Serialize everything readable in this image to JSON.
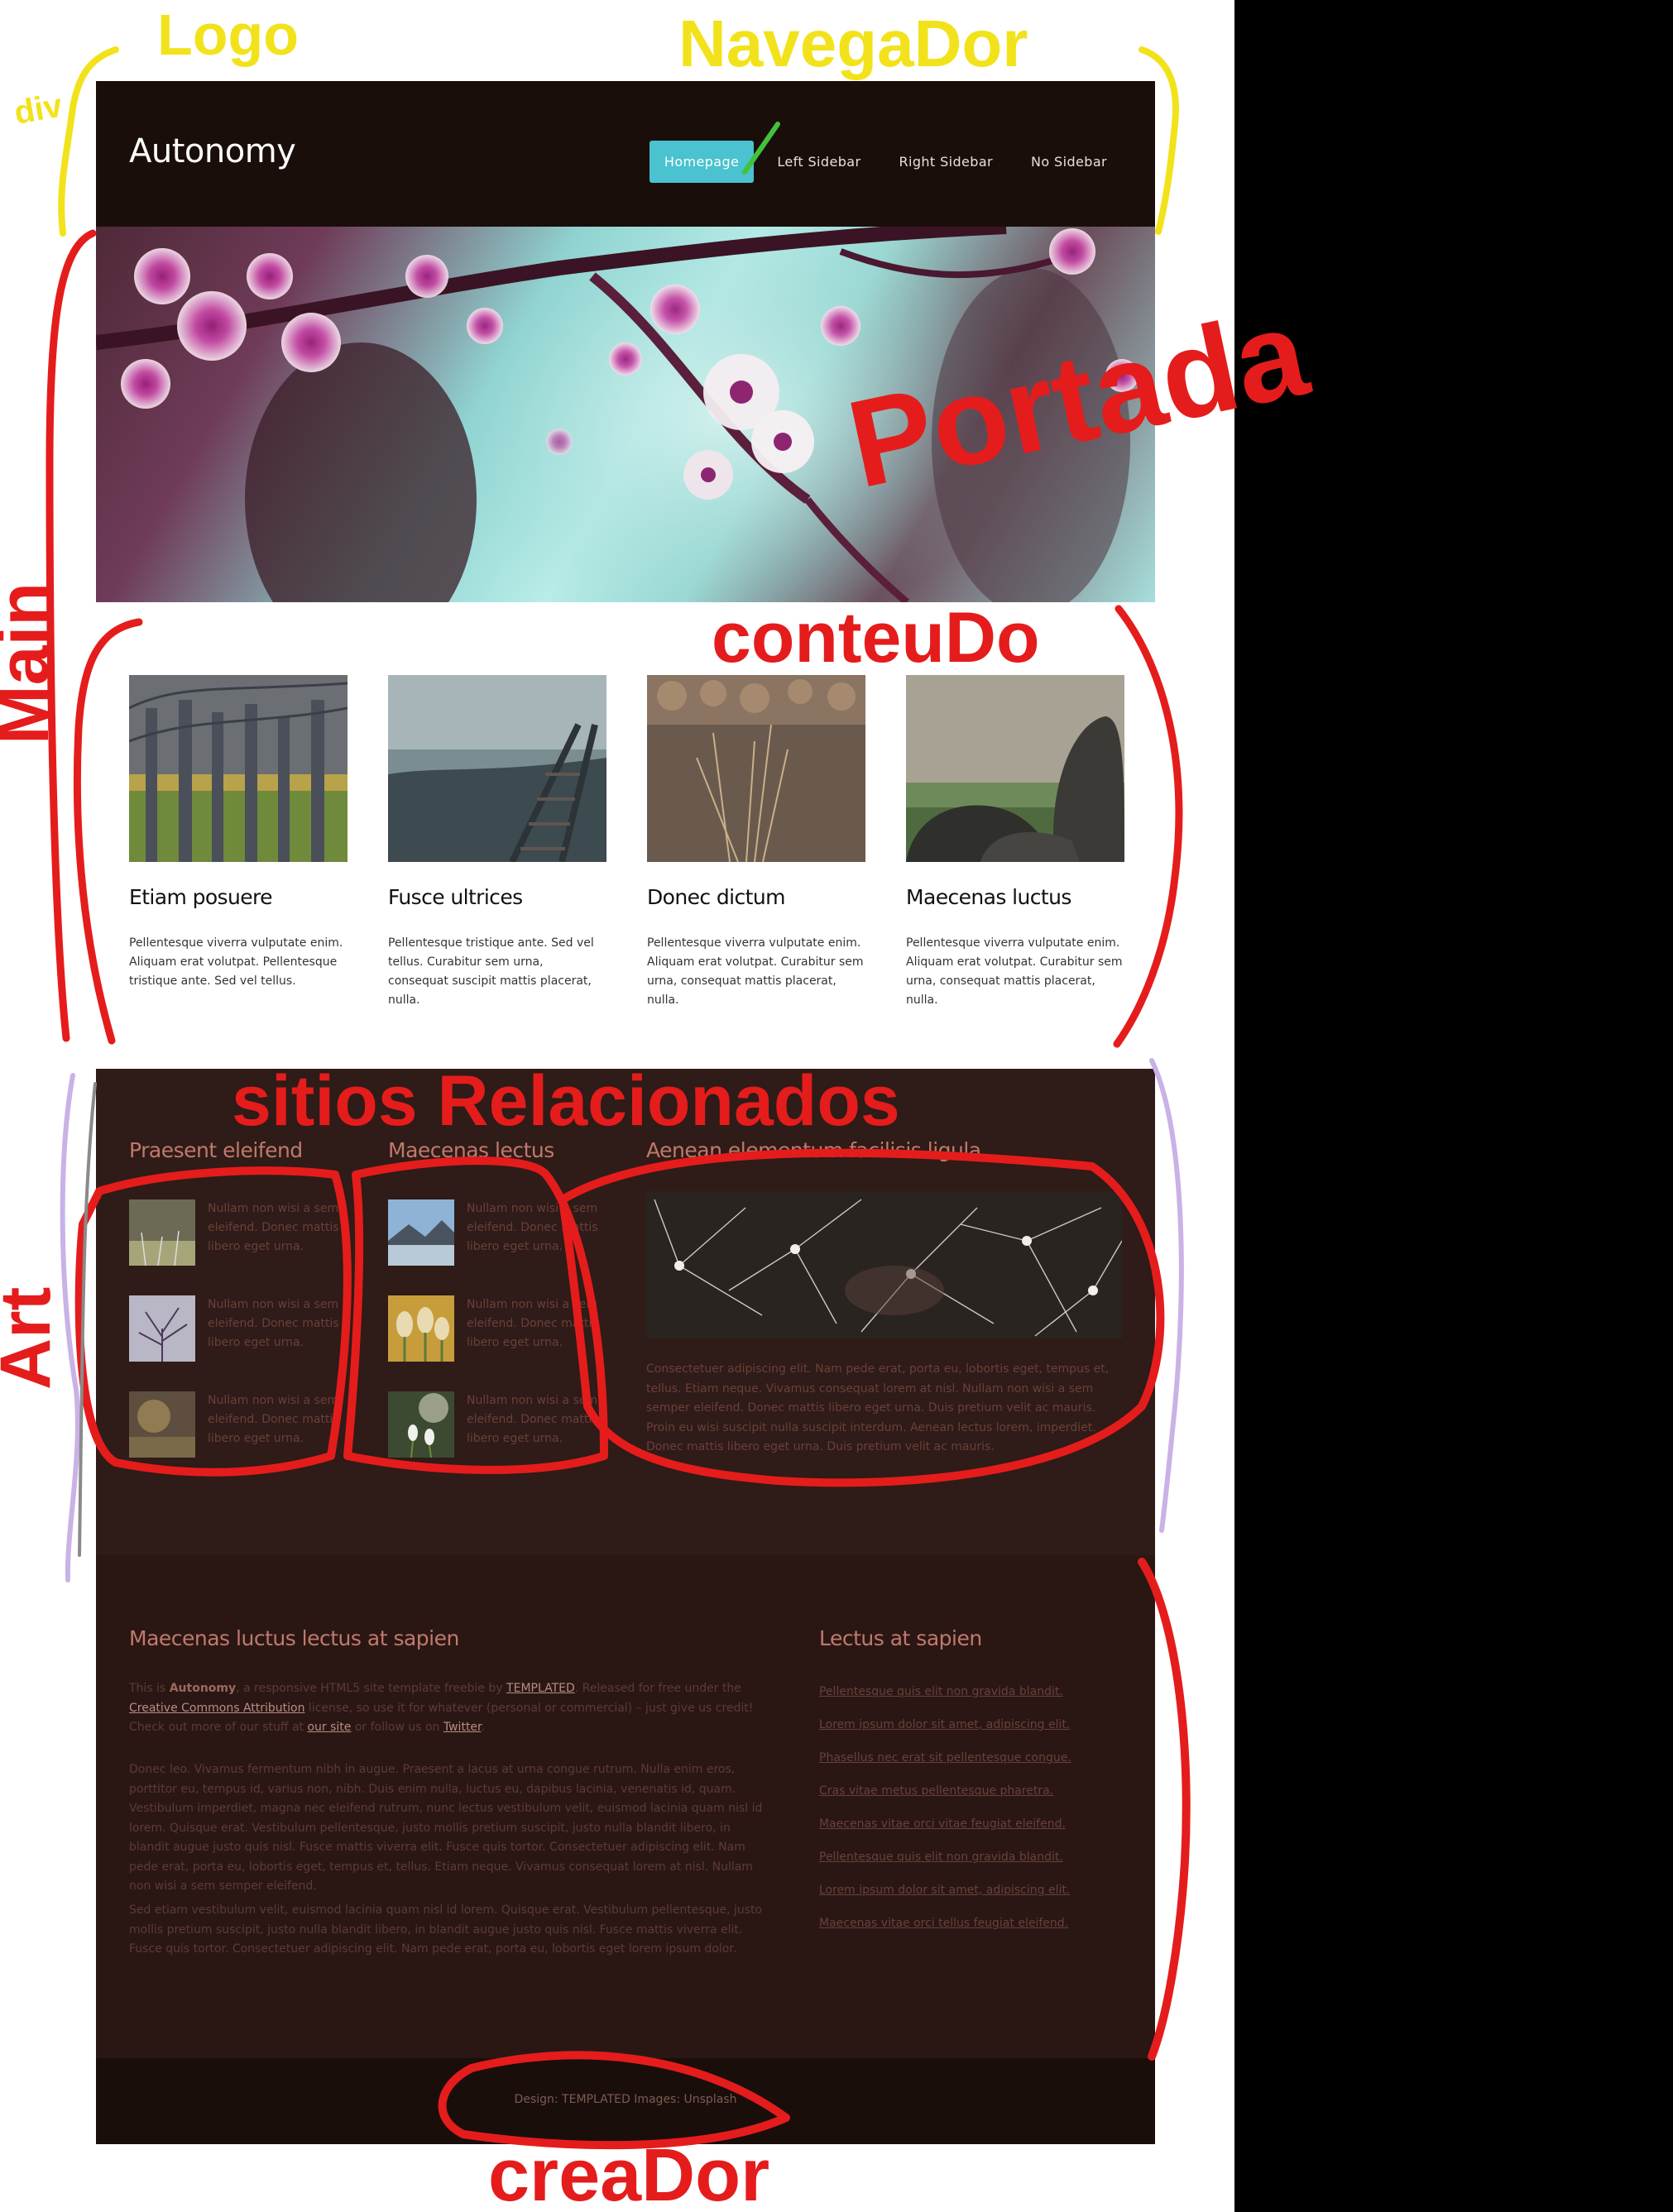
{
  "site": {
    "logo": "Autonomy",
    "nav": [
      {
        "label": "Homepage",
        "active": true
      },
      {
        "label": "Left Sidebar",
        "active": false
      },
      {
        "label": "Right Sidebar",
        "active": false
      },
      {
        "label": "No Sidebar",
        "active": false
      }
    ],
    "accent": "#4ac2cf"
  },
  "content": {
    "cards": [
      {
        "title": "Etiam posuere",
        "text": "Pellentesque viverra vulputate enim. Aliquam erat volutpat. Pellentesque tristique ante. Sed vel tellus."
      },
      {
        "title": "Fusce ultrices",
        "text": "Pellentesque tristique ante. Sed vel tellus. Curabitur sem urna, consequat suscipit mattis placerat, nulla."
      },
      {
        "title": "Donec dictum",
        "text": "Pellentesque viverra vulputate enim. Aliquam erat volutpat. Curabitur sem urna, consequat mattis placerat, nulla."
      },
      {
        "title": "Maecenas luctus",
        "text": "Pellentesque viverra vulputate enim. Aliquam erat volutpat. Curabitur sem urna, consequat mattis placerat, nulla."
      }
    ]
  },
  "related": {
    "col1_title": "Praesent eleifend",
    "col2_title": "Maecenas lectus",
    "col3_title": "Aenean elementum facilisis ligula",
    "item_text": "Nullam non wisi a sem eleifend. Donec mattis libero eget urna.",
    "featured_text": "Consectetuer adipiscing elit. Nam pede erat, porta eu, lobortis eget, tempus et, tellus. Etiam neque. Vivamus consequat lorem at nisl. Nullam non wisi a sem semper eleifend. Donec mattis libero eget urna. Duis pretium velit ac mauris. Proin eu wisi suscipit nulla suscipit interdum. Aenean lectus lorem, imperdiet. Donec mattis libero eget urna. Duis pretium velit ac mauris."
  },
  "footer": {
    "left_title": "Maecenas luctus lectus at sapien",
    "intro": {
      "p1": "This is ",
      "brand": "Autonomy",
      "p2": ", a responsive HTML5 site template freebie by ",
      "link1": "TEMPLATED",
      "p3": ". Released for free under the ",
      "link2": "Creative Commons Attribution",
      "p4": " license, so use it for whatever (personal or commercial) – just give us credit! Check out more of our stuff at ",
      "link3": "our site",
      "p5": " or follow us on ",
      "link4": "Twitter",
      "p6": "."
    },
    "para2": "Donec leo. Vivamus fermentum nibh in augue. Praesent a lacus at urna congue rutrum. Nulla enim eros, porttitor eu, tempus id, varius non, nibh. Duis enim nulla, luctus eu, dapibus lacinia, venenatis id, quam. Vestibulum imperdiet, magna nec eleifend rutrum, nunc lectus vestibulum velit, euismod lacinia quam nisl id lorem. Quisque erat. Vestibulum pellentesque, justo mollis pretium suscipit, justo nulla blandit libero, in blandit augue justo quis nisl. Fusce mattis viverra elit. Fusce quis tortor. Consectetuer adipiscing elit. Nam pede erat, porta eu, lobortis eget, tempus et, tellus. Etiam neque. Vivamus consequat lorem at nisl. Nullam non wisi a sem semper eleifend.",
    "para3": "Sed etiam vestibulum velit, euismod lacinia quam nisl id lorem. Quisque erat. Vestibulum pellentesque, justo mollis pretium suscipit, justo nulla blandit libero, in blandit augue justo quis nisl. Fusce mattis viverra elit. Fusce quis tortor. Consectetuer adipiscing elit. Nam pede erat, porta eu, lobortis eget lorem ipsum dolor.",
    "right_title": "Lectus at sapien",
    "links": [
      "Pellentesque quis elit non gravida blandit.",
      "Lorem ipsum dolor sit amet, adipiscing elit.",
      "Phasellus nec erat sit pellentesque congue.",
      "Cras vitae metus pellentesque pharetra.",
      "Maecenas vitae orci vitae feugiat eleifend.",
      "Pellentesque quis elit non gravida blandit.",
      "Lorem ipsum dolor sit amet, adipiscing elit.",
      "Maecenas vitae orci tellus feugiat eleifend."
    ],
    "credit": "Design: TEMPLATED Images: Unsplash"
  },
  "annotations": {
    "logo": "Logo",
    "navegador": "NavegaDor",
    "div": "div",
    "portada": "Portada",
    "main": "Main",
    "conteudo": "conteuDo",
    "sitios": "sitios Relacionados",
    "art": "Art",
    "creador": "creaDor",
    "yellow": "#f2e21b",
    "red": "#e51c1c"
  }
}
